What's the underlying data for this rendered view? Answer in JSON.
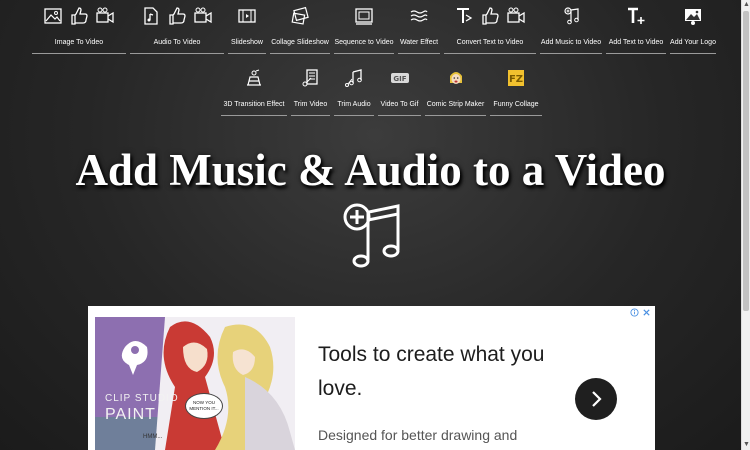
{
  "nav_row_1": [
    {
      "label": "Image To Video",
      "icons": [
        "image-icon",
        "thumbs-up-icon",
        "video-camera-icon"
      ]
    },
    {
      "label": "Audio To Video",
      "icons": [
        "audio-file-icon",
        "thumbs-up-icon",
        "video-camera-icon"
      ]
    },
    {
      "label": "Slideshow",
      "icons": [
        "slideshow-icon"
      ]
    },
    {
      "label": "Collage Slideshow",
      "icons": [
        "collage-icon"
      ]
    },
    {
      "label": "Sequence to Video",
      "icons": [
        "sequence-icon"
      ]
    },
    {
      "label": "Water Effect",
      "icons": [
        "water-waves-icon"
      ]
    },
    {
      "label": "Convert Text to Video",
      "icons": [
        "text-icon",
        "thumbs-up-icon",
        "video-camera-icon"
      ]
    },
    {
      "label": "Add Music to Video",
      "icons": [
        "music-add-icon"
      ]
    },
    {
      "label": "Add Text to Video",
      "icons": [
        "text-plus-icon"
      ]
    },
    {
      "label": "Add Your Logo",
      "icons": [
        "logo-image-icon"
      ]
    }
  ],
  "nav_row_2": [
    {
      "label": "3D Transition Effect",
      "icons": [
        "transition-3d-icon"
      ]
    },
    {
      "label": "Trim Video",
      "icons": [
        "trim-video-icon"
      ]
    },
    {
      "label": "Trim Audio",
      "icons": [
        "trim-audio-icon"
      ]
    },
    {
      "label": "Video To Gif",
      "icons": [
        "gif-icon"
      ]
    },
    {
      "label": "Comic Strip Maker",
      "icons": [
        "comic-face-icon"
      ]
    },
    {
      "label": "Funny Collage",
      "icons": [
        "funny-collage-icon"
      ]
    }
  ],
  "page": {
    "title": "Add Music & Audio to a Video",
    "logo_icon": "music-notes-plus-icon"
  },
  "ad": {
    "headline": "Tools to create what you love.",
    "body": "Designed for better drawing and",
    "brand_line1": "CLIP STUDIO",
    "brand_line2": "PAINT",
    "speech_text": "NOW YOU MENTION IT...",
    "speech_text_2": "HMM...",
    "next_icon": "chevron-right-icon",
    "choices_icon": "ad-choices-icon",
    "close_icon": "close-icon",
    "colors": {
      "accent": "#4a90e2",
      "button": "#1f1f1f"
    }
  }
}
